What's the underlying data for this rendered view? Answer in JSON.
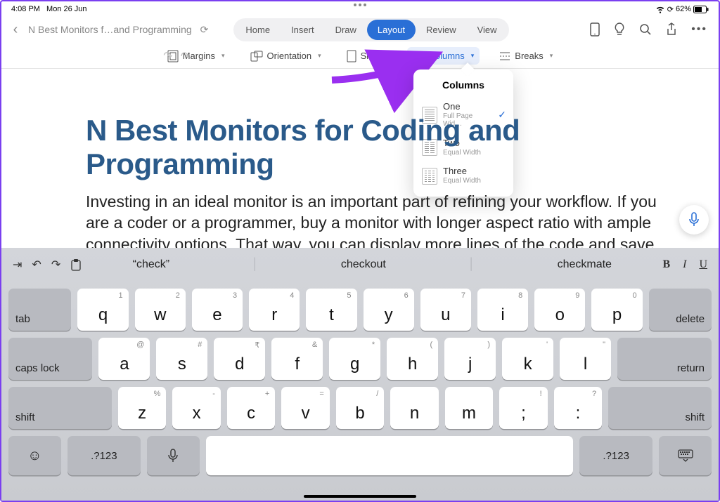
{
  "status": {
    "time": "4:08 PM",
    "date": "Mon 26 Jun",
    "battery": "62%"
  },
  "doc": {
    "filename": "N Best Monitors f…and Programming",
    "title": "N Best Monitors for Coding and Programming",
    "body": "Investing in an ideal monitor is an important part of refining your workflow. If you are a coder or a programmer, buy a monitor with longer aspect ratio with ample connectivity options. That way, you can display more lines of the code and save yourself from constant scrolling. With several manufactures and"
  },
  "tabs": {
    "items": [
      "Home",
      "Insert",
      "Draw",
      "Layout",
      "Review",
      "View"
    ],
    "active": "Layout"
  },
  "ribbon": {
    "margins": "Margins",
    "orientation": "Orientation",
    "size": "Size",
    "columns": "Columns",
    "breaks": "Breaks"
  },
  "popover": {
    "title": "Columns",
    "items": [
      {
        "label": "One",
        "sub": "Full Page Wid…",
        "cols": 1,
        "checked": true
      },
      {
        "label": "Two",
        "sub": "Equal Width",
        "cols": 2,
        "checked": false
      },
      {
        "label": "Three",
        "sub": "Equal Width",
        "cols": 3,
        "checked": false
      }
    ]
  },
  "keyboard": {
    "suggestions": [
      "“check”",
      "checkout",
      "checkmate"
    ],
    "row1": [
      {
        "k": "q",
        "a": "1"
      },
      {
        "k": "w",
        "a": "2"
      },
      {
        "k": "e",
        "a": "3"
      },
      {
        "k": "r",
        "a": "4"
      },
      {
        "k": "t",
        "a": "5"
      },
      {
        "k": "y",
        "a": "6"
      },
      {
        "k": "u",
        "a": "7"
      },
      {
        "k": "i",
        "a": "8"
      },
      {
        "k": "o",
        "a": "9"
      },
      {
        "k": "p",
        "a": "0"
      }
    ],
    "row2": [
      {
        "k": "a",
        "a": "@"
      },
      {
        "k": "s",
        "a": "#"
      },
      {
        "k": "d",
        "a": "₹"
      },
      {
        "k": "f",
        "a": "&"
      },
      {
        "k": "g",
        "a": "*"
      },
      {
        "k": "h",
        "a": "("
      },
      {
        "k": "j",
        "a": ")"
      },
      {
        "k": "k",
        "a": "'"
      },
      {
        "k": "l",
        "a": "\""
      }
    ],
    "row3": [
      {
        "k": "z",
        "a": "%"
      },
      {
        "k": "x",
        "a": "-"
      },
      {
        "k": "c",
        "a": "+"
      },
      {
        "k": "v",
        "a": "="
      },
      {
        "k": "b",
        "a": "/"
      },
      {
        "k": "n",
        "a": ""
      },
      {
        "k": "m",
        "a": ""
      },
      {
        "k": ";",
        "a": "!"
      },
      {
        "k": ":",
        "a": "?"
      }
    ],
    "tab": "tab",
    "caps": "caps lock",
    "shift": "shift",
    "delete": "delete",
    "return": "return",
    "num": ".?123"
  }
}
